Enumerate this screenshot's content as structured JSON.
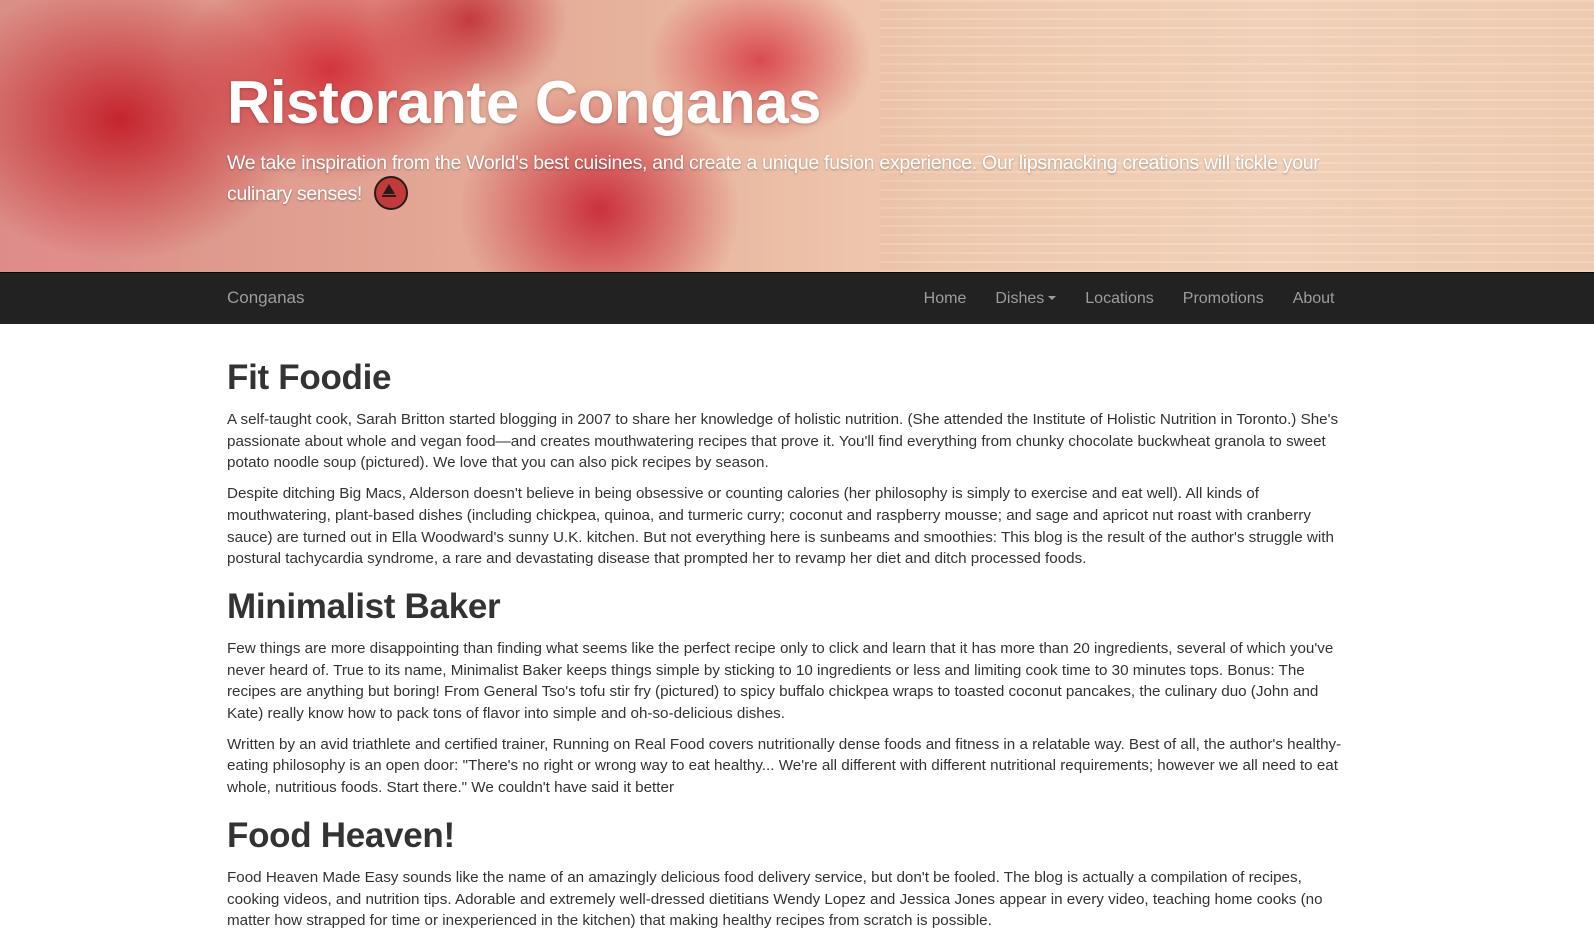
{
  "header": {
    "title": "Ristorante Conganas",
    "subtitle": "We take inspiration from the World's best cuisines, and create a unique fusion experience. Our lipsmacking creations will tickle your culinary senses!",
    "logo_icon": "restaurant-logo-icon"
  },
  "navbar": {
    "brand": "Conganas",
    "links": [
      "Home",
      "Dishes",
      "Locations",
      "Promotions",
      "About"
    ]
  },
  "sections": [
    {
      "heading": "Fit Foodie",
      "paragraphs": [
        "A self-taught cook, Sarah Britton started blogging in 2007 to share her knowledge of holistic nutrition. (She attended the Institute of Holistic Nutrition in Toronto.) She's passionate about whole and vegan food—and creates mouthwatering recipes that prove it. You'll find everything from chunky chocolate buckwheat granola to sweet potato noodle soup (pictured). We love that you can also pick recipes by season.",
        "Despite ditching Big Macs, Alderson doesn't believe in being obsessive or counting calories (her philosophy is simply to exercise and eat well). All kinds of mouthwatering, plant-based dishes (including chickpea, quinoa, and turmeric curry; coconut and raspberry mousse; and sage and apricot nut roast with cranberry sauce) are turned out in Ella Woodward's sunny U.K. kitchen. But not everything here is sunbeams and smoothies: This blog is the result of the author's struggle with postural tachycardia syndrome, a rare and devastating disease that prompted her to revamp her diet and ditch processed foods."
      ]
    },
    {
      "heading": "Minimalist Baker",
      "paragraphs": [
        "Few things are more disappointing than finding what seems like the perfect recipe only to click and learn that it has more than 20 ingredients, several of which you've never heard of. True to its name, Minimalist Baker keeps things simple by sticking to 10 ingredients or less and limiting cook time to 30 minutes tops. Bonus: The recipes are anything but boring! From General Tso's tofu stir fry (pictured) to spicy buffalo chickpea wraps to toasted coconut pancakes, the culinary duo (John and Kate) really know how to pack tons of flavor into simple and oh-so-delicious dishes.",
        "Written by an avid triathlete and certified trainer, Running on Real Food covers nutritionally dense foods and fitness in a relatable way. Best of all, the author's healthy-eating philosophy is an open door: \"There's no right or wrong way to eat healthy... We're all different with different nutritional requirements; however we all need to eat whole, nutritious foods. Start there.\" We couldn't have said it better"
      ]
    },
    {
      "heading": "Food Heaven!",
      "paragraphs": [
        "Food Heaven Made Easy sounds like the name of an amazingly delicious food delivery service, but don't be fooled. The blog is actually a compilation of recipes, cooking videos, and nutrition tips. Adorable and extremely well-dressed dietitians Wendy Lopez and Jessica Jones appear in every video, teaching home cooks (no matter how strapped for time or inexperienced in the kitchen) that making healthy recipes from scratch is possible."
      ]
    }
  ]
}
